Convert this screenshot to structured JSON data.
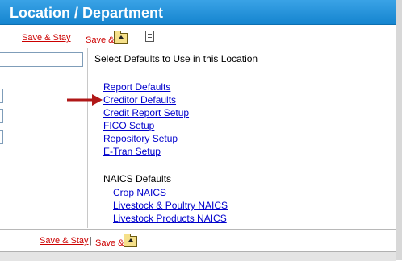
{
  "window": {
    "title": "Location / Department"
  },
  "toolbar": {
    "save_stay_label": "Save & Stay",
    "separator": "|",
    "save_label": "Save &"
  },
  "main": {
    "section_header": "Select Defaults to Use in this Location",
    "default_links": [
      "Report Defaults",
      "Creditor Defaults",
      "Credit Report Setup",
      "FICO Setup",
      "Repository Setup",
      "E-Tran Setup"
    ],
    "naics_header": "NAICS Defaults",
    "naics_links": [
      "Crop NAICS",
      "Livestock & Poultry NAICS",
      "Livestock Products NAICS"
    ]
  },
  "footer": {
    "save_stay_label": "Save & Stay",
    "separator": "|",
    "save_label": "Save &"
  },
  "colors": {
    "titlebar": "#1a8bd6",
    "link": "#0000cc",
    "action_link": "#cc0000",
    "arrow": "#b01818"
  },
  "icons": [
    "folder-up-icon",
    "document-icon",
    "red-arrow-icon"
  ]
}
